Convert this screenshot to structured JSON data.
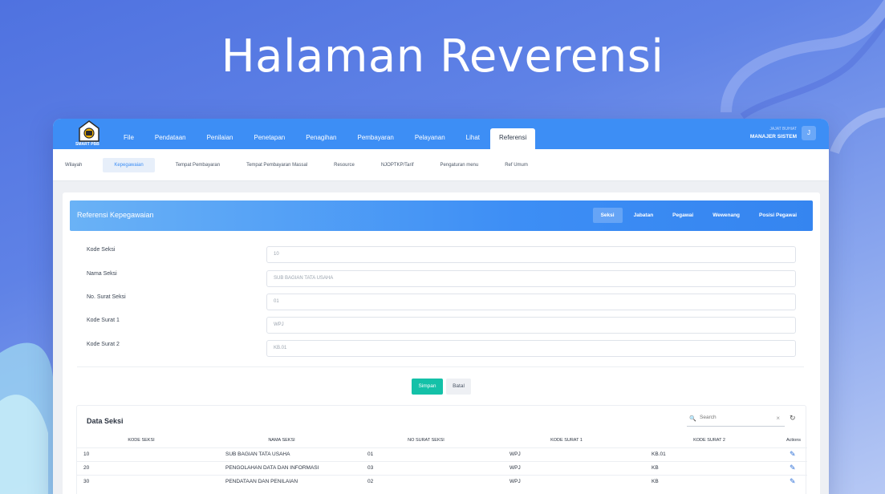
{
  "hero": {
    "title": "Halaman Reverensi"
  },
  "app": {
    "logo_text": "SMART PBB",
    "menu": [
      {
        "label": "File"
      },
      {
        "label": "Pendataan"
      },
      {
        "label": "Penilaian"
      },
      {
        "label": "Penetapan"
      },
      {
        "label": "Penagihan"
      },
      {
        "label": "Pembayaran"
      },
      {
        "label": "Pelayanan"
      },
      {
        "label": "Lihat"
      },
      {
        "label": "Referensi"
      }
    ],
    "active_menu": "Referensi",
    "user": {
      "name": "JAJAT BUHIAT",
      "role": "MANAJER SISTEM",
      "initial": "J"
    },
    "subnav": [
      {
        "label": "Wilayah"
      },
      {
        "label": "Kepegawaian"
      },
      {
        "label": "Tempat Pembayaran"
      },
      {
        "label": "Tempat Pembayaran Massal"
      },
      {
        "label": "Resource"
      },
      {
        "label": "NJOPTKP/Tarif"
      },
      {
        "label": "Pengaturan menu"
      },
      {
        "label": "Ref Umum"
      }
    ],
    "active_subnav": "Kepegawaian"
  },
  "panel": {
    "title": "Referensi Kepegawaian",
    "tabs": [
      "Seksi",
      "Jabatan",
      "Pegawai",
      "Wewenang",
      "Posisi Pegawai"
    ],
    "active_tab": "Seksi",
    "fields": [
      {
        "label": "Kode Seksi",
        "value": "10"
      },
      {
        "label": "Nama Seksi",
        "value": "SUB BAGIAN TATA USAHA"
      },
      {
        "label": "No. Surat Seksi",
        "value": "01"
      },
      {
        "label": "Kode Surat 1",
        "value": "WPJ"
      },
      {
        "label": "Kode Surat 2",
        "value": "KB.01"
      }
    ],
    "save_label": "Simpan",
    "cancel_label": "Batal"
  },
  "table": {
    "title": "Data Seksi",
    "search_placeholder": "Search",
    "columns": [
      "KODE SEKSI",
      "NAMA SEKSI",
      "NO SURAT SEKSI",
      "KODE SURAT 1",
      "KODE SURAT 2",
      "Actions"
    ],
    "rows": [
      [
        "10",
        "SUB BAGIAN TATA USAHA",
        "01",
        "WPJ",
        "KB.01"
      ],
      [
        "20",
        "PENGOLAHAN DATA DAN INFORMASI",
        "03",
        "WPJ",
        "KB"
      ],
      [
        "30",
        "PENDATAAN DAN PENILAIAN",
        "02",
        "WPJ",
        "KB"
      ]
    ]
  },
  "colors": {
    "primary": "#3d8ef5",
    "save": "#14c1a8",
    "edit_icon": "#2d6fd6"
  }
}
